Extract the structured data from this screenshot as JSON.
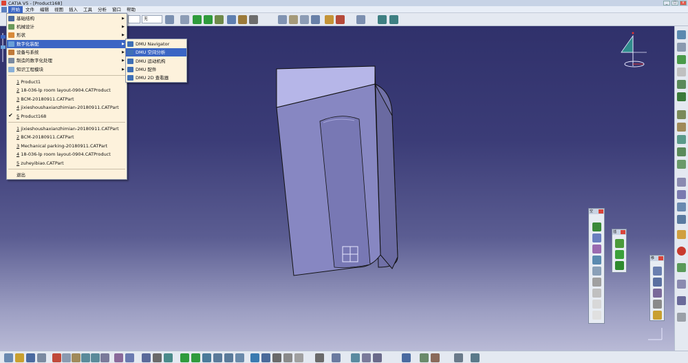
{
  "window": {
    "title": "CATIA V5 - [Product168]"
  },
  "menubar": {
    "items": [
      {
        "label": "开始",
        "active": true
      },
      {
        "label": "文件"
      },
      {
        "label": "编辑"
      },
      {
        "label": "视图"
      },
      {
        "label": "插入"
      },
      {
        "label": "工具"
      },
      {
        "label": "分析"
      },
      {
        "label": "窗口"
      },
      {
        "label": "帮助"
      }
    ]
  },
  "toolbar_top": {
    "select1_value": "",
    "select2_value": "无"
  },
  "start_menu": {
    "workbenches": [
      {
        "label": "基础结构"
      },
      {
        "label": "机械设计"
      },
      {
        "label": "形状"
      },
      {
        "label": "数字化装配",
        "highlighted": true
      },
      {
        "label": "设备与系统"
      },
      {
        "label": "制造的数字化处理"
      },
      {
        "label": "知识工程模块"
      }
    ],
    "recent_group1": [
      {
        "num": "1",
        "label": "Product1"
      },
      {
        "num": "2",
        "label": "18-036-lp room layout-0904.CATProduct"
      },
      {
        "num": "3",
        "label": "BCM-20180911.CATPart"
      },
      {
        "num": "4",
        "label": "jixieshoushaxianzhimian-20180911.CATPart"
      },
      {
        "num": "5",
        "label": "Product168",
        "checked": true
      }
    ],
    "recent_group2": [
      {
        "num": "1",
        "label": "jixieshoushaxianzhimian-20180911.CATPart"
      },
      {
        "num": "2",
        "label": "BCM-20180911.CATPart"
      },
      {
        "num": "3",
        "label": "Mechanical parking-20180911.CATPart"
      },
      {
        "num": "4",
        "label": "18-036-lp room layout-0904.CATProduct"
      },
      {
        "num": "5",
        "label": "zuheyibiao.CATPart"
      }
    ],
    "exit_label": "退出"
  },
  "dmu_submenu": {
    "items": [
      {
        "label": "DMU Navigator"
      },
      {
        "label": "DMU 空间分析",
        "highlighted": true
      },
      {
        "label": "DMU 运动机构"
      },
      {
        "label": "DMU 配件"
      },
      {
        "label": "DMU 2D 查看器"
      }
    ]
  },
  "palettes": {
    "p1_title": "空",
    "p2_title": "插",
    "p3_title": "移"
  },
  "colors": {
    "menu_bg": "#fdf2dc",
    "highlight": "#3b66c4",
    "part_face": "#8e8fc9",
    "part_top": "#b9b9ea"
  }
}
